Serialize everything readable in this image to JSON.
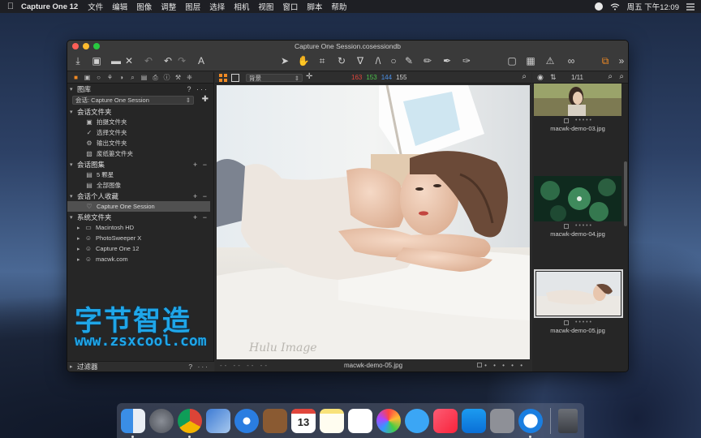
{
  "menubar": {
    "app_name": "Capture One 12",
    "items": [
      "文件",
      "编辑",
      "图像",
      "调整",
      "图层",
      "选择",
      "相机",
      "视图",
      "窗口",
      "脚本",
      "帮助"
    ],
    "clock": "周五 下午12:09"
  },
  "window": {
    "title": "Capture One Session.cosessiondb"
  },
  "library": {
    "header": "图库",
    "session_select": "会话: Capture One Session",
    "session_folders_header": "会话文件夹",
    "session_folders": [
      "拍摄文件夹",
      "选择文件夹",
      "输出文件夹",
      "废纸篓文件夹"
    ],
    "session_albums_header": "会话图集",
    "session_albums": [
      "5 颗星",
      "全部图像"
    ],
    "favorites_header": "会话个人收藏",
    "favorites": [
      "Capture One Session"
    ],
    "system_folders_header": "系统文件夹",
    "system_folders": [
      "Macintosh HD",
      "PhotoSweeper X",
      "Capture One 12",
      "macwk.com"
    ],
    "filter_header": "过滤器",
    "header_actions": "? ···"
  },
  "viewer": {
    "background_select": "背景",
    "rgb": {
      "r": "163",
      "g": "153",
      "b": "144",
      "l": "155"
    },
    "filename": "macwk-demo-05.jpg",
    "photo_signature": "Hulu Image",
    "foot_left": "-- -- -- --",
    "foot_right": "• • • • •"
  },
  "browser": {
    "counter": "1/11",
    "thumbs": [
      {
        "name": "macwk-demo-03.jpg",
        "selected": false
      },
      {
        "name": "macwk-demo-04.jpg",
        "selected": false
      },
      {
        "name": "macwk-demo-05.jpg",
        "selected": true
      }
    ],
    "rating_dots": "• • • • •"
  },
  "watermark": {
    "line1": "字节智造",
    "line2": "www.zsxcool.com"
  },
  "colors": {
    "accent": "#f08a24",
    "red": "#e0463c",
    "green": "#4cc24c",
    "blue": "#4a8fe6",
    "watermark": "#1fa6e8"
  },
  "dock": {
    "apps": [
      "finder-icon",
      "launchpad-icon",
      "chrome-icon",
      "preview-icon",
      "safari-icon",
      "notes-book-icon",
      "calendar-icon",
      "notes-icon",
      "reminders-icon",
      "photos-icon",
      "messages-icon",
      "music-icon",
      "app-store-icon",
      "system-preferences-icon",
      "onepassword-icon",
      "trash-icon"
    ],
    "calendar_day": "13"
  }
}
